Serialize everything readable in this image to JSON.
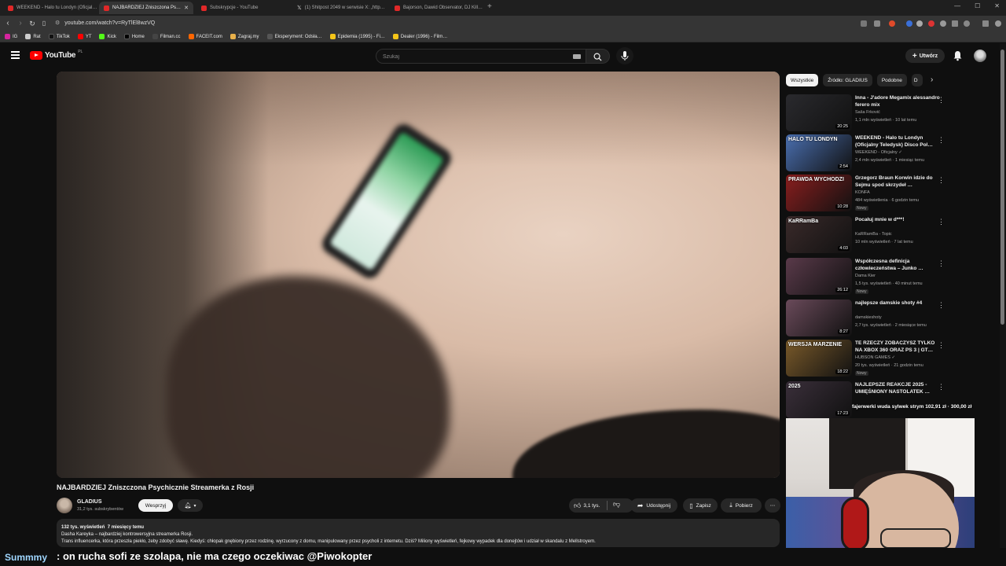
{
  "browser": {
    "tabs": [
      {
        "label": "WEEKEND - Halo tu Londyn (Oficjal…",
        "active": false
      },
      {
        "label": "NAJBARDZIEJ Zniszczona Ps…",
        "active": true
      },
      {
        "label": "Subskrypcje - YouTube",
        "active": false
      },
      {
        "label": "(1) Shitpost 2049 w serwisie X: „http…",
        "active": false
      },
      {
        "label": "Bajorson, Dawid Observator, DJ Kill…",
        "active": false
      }
    ],
    "url": "youtube.com/watch?v=RyTlEl8wzVQ",
    "bookmarks": [
      "IG",
      "Rat",
      "TikTok",
      "YT",
      "Kick",
      "Home",
      "Filman.cc",
      "FACEIT.com",
      "Zagraj.my",
      "Eksperyment: Odsła…",
      "Epidemia (1995) - Fi…",
      "Dealer (1996) - Film…"
    ]
  },
  "header": {
    "logo": "YouTube",
    "country": "PL",
    "search_placeholder": "Szukaj",
    "create_label": "Utwórz"
  },
  "video": {
    "title": "NAJBARDZIEJ Zniszczona Psychicznie Streamerka z Rosji",
    "channel": "GLADIUS",
    "subscribers": "31,2 tys. subskrybentów",
    "support_label": "Wesprzyj",
    "likes": "3,1 tys.",
    "share_label": "Udostępnij",
    "save_label": "Zapisz",
    "download_label": "Pobierz",
    "views": "132 tys. wyświetleń",
    "published": "7 miesięcy temu",
    "desc_line1": "Dasha Kareyka – najbardziej kontrowersyjna streamerka Rosji.",
    "desc_line2": "Trans influencerka, która przeszła piekło, żeby zdobyć sławę. Kiedyś: chłopak gnębiony przez rodzinę, wyrzucony z domu, manipulowany przez psycholi z internetu. Dziś? Miliony wyświetleń, fejkowy wypadek dla donejtów i udział w skandalu z Mellstroyem."
  },
  "sidebar": {
    "chips": [
      "Wszystkie",
      "Źródło: GLADIUS",
      "Podobne",
      "D"
    ],
    "recs": [
      {
        "title": "Inna - J'adore Megamix alessandro ferero mix",
        "channel": "Saša Frković",
        "meta": "1,1 mln wyświetleń · 10 lat temu",
        "duration": "20:25",
        "badge": "",
        "thumb_label": "",
        "thumb_color": "#2a2a2e"
      },
      {
        "title": "WEEKEND - Halo tu Londyn (Oficjalny Teledysk) Disco Pol…",
        "channel": "WEEKEND - Oficjalny ✓",
        "meta": "2,4 mln wyświetleń · 1 miesiąc temu",
        "duration": "2:54",
        "badge": "",
        "thumb_label": "HALO TU LONDYN",
        "thumb_color": "#4a6fb0"
      },
      {
        "title": "Grzegorz Braun Korwin idzie do Sejmu spod skrzydeł …",
        "channel": "KONFA",
        "meta": "484 wyświetlenia · 6 godzin temu",
        "duration": "10:28",
        "badge": "Nowy",
        "thumb_label": "PRAWDA WYCHODZI",
        "thumb_color": "#8a1e1e"
      },
      {
        "title": "Pocałuj mnie w d***!",
        "channel": "KaRRamBa - Topic",
        "meta": "10 mln wyświetleń · 7 lat temu",
        "duration": "4:03",
        "badge": "",
        "thumb_label": "KaRRamBa",
        "thumb_color": "#3a2a2a"
      },
      {
        "title": "Współczesna definicja człowieczeństwa – Junko …",
        "channel": "Dama Kier",
        "meta": "1,5 tys. wyświetleń · 40 minut temu",
        "duration": "26:12",
        "badge": "Nowy",
        "thumb_label": "",
        "thumb_color": "#5a3a4a"
      },
      {
        "title": "najlepsze damskie shoty #4",
        "channel": "damskieshoty",
        "meta": "2,7 tys. wyświetleń · 2 miesiące temu",
        "duration": "8:27",
        "badge": "",
        "thumb_label": "",
        "thumb_color": "#6a4a5a"
      },
      {
        "title": "TE RZECZY ZOBACZYSZ TYLKO NA XBOX 360 ORAZ PS 3 | GT…",
        "channel": "HUBSON GAMES ✓",
        "meta": "20 tys. wyświetleń · 21 godzin temu",
        "duration": "18:22",
        "badge": "Nowy",
        "thumb_label": "WERSJA MARZENIE",
        "thumb_color": "#7a5a2a"
      },
      {
        "title": "NAJLEPSZE REAKCJE 2025 - UMIĘŚNIONY NASTOLATEK …",
        "channel": "",
        "meta": "",
        "duration": "17:23",
        "badge": "",
        "thumb_label": "2025",
        "thumb_color": "#3a2f3a"
      }
    ]
  },
  "overlay": {
    "donation": "fajerwerki wuda sylwek strym 102,91 zł · 300,00 zł",
    "chat_user": "Summmy",
    "chat_message": ": on rucha sofi ze szolapa, nie ma czego oczekiwac @Piwokopter"
  },
  "colors": {
    "background": "#0f0f0f",
    "accent_red": "#ff0000",
    "chip_active": "#f1f1f1"
  }
}
